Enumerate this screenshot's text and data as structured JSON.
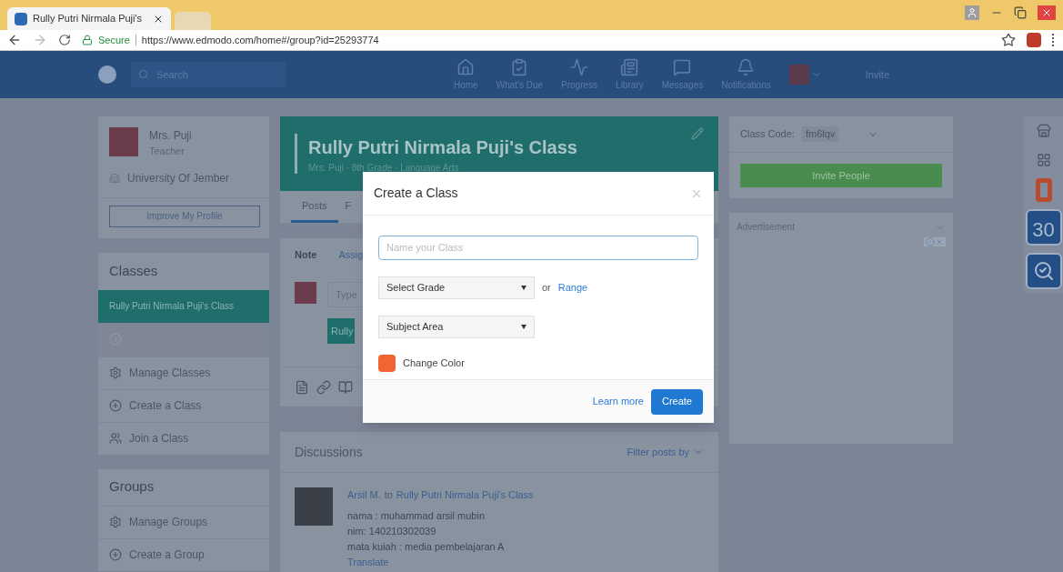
{
  "browser": {
    "tab_title": "Rully Putri Nirmala Puji's",
    "secure_label": "Secure",
    "url": "https://www.edmodo.com/home#/group?id=25293774"
  },
  "navbar": {
    "search_placeholder": "Search",
    "items": [
      {
        "label": "Home",
        "kind": "home"
      },
      {
        "label": "What's Due",
        "kind": "due"
      },
      {
        "label": "Progress",
        "kind": "progress"
      },
      {
        "label": "Library",
        "kind": "library"
      },
      {
        "label": "Messages",
        "kind": "messages"
      },
      {
        "label": "Notifications",
        "kind": "notifications"
      }
    ],
    "invite": "Invite"
  },
  "profile": {
    "name": "Mrs. Puji",
    "role": "Teacher",
    "school": "University Of Jember",
    "button": "Improve My Profile"
  },
  "classes": {
    "title": "Classes",
    "items": [
      {
        "label": "Rully Putri Nirmala Puji's Class",
        "selected": true
      }
    ],
    "actions": [
      {
        "label": "Manage Classes",
        "kind": "manage"
      },
      {
        "label": "Create a Class",
        "kind": "create"
      },
      {
        "label": "Join a Class",
        "kind": "join"
      }
    ]
  },
  "groups": {
    "title": "Groups",
    "actions": [
      {
        "label": "Manage Groups",
        "kind": "manage"
      },
      {
        "label": "Create a Group",
        "kind": "create"
      }
    ]
  },
  "class_header": {
    "title": "Rully Putri Nirmala Puji's Class",
    "subtitle": "Mrs. Puji · 8th Grade · Language Arts"
  },
  "class_tabs": [
    {
      "label": "Posts",
      "selected": true
    },
    {
      "label": "F",
      "selected": false
    }
  ],
  "composer": {
    "tabs": [
      {
        "label": "Note",
        "selected": true
      },
      {
        "label": "Assig",
        "selected": false
      }
    ],
    "placeholder": "Type",
    "chip": "Rully"
  },
  "discussions": {
    "title": "Discussions",
    "filter": "Filter posts by",
    "post": {
      "author": "Arsil M.",
      "connector": "to",
      "target": "Rully Putri Nirmala Puji's Class",
      "lines": [
        "nama : muhammad arsil mubin",
        "nim: 140210302039",
        "mata kuiah : media pembelajaran A"
      ],
      "translate": "Translate"
    }
  },
  "class_code": {
    "label": "Class Code:",
    "code": "fm6lqv",
    "invite": "Invite People"
  },
  "advertisement": {
    "label": "Advertisement"
  },
  "apps": [
    {
      "kind": "store"
    },
    {
      "kind": "grid"
    },
    {
      "kind": "office"
    },
    {
      "kind": "calendar",
      "label": "30"
    },
    {
      "kind": "quiz"
    }
  ],
  "modal": {
    "title": "Create a Class",
    "name_placeholder": "Name your Class",
    "grade_select": "Select Grade",
    "or": "or",
    "range": "Range",
    "subject_select": "Subject Area",
    "color": {
      "label": "Change Color",
      "color": "#f26531"
    },
    "learn_more": "Learn more",
    "create": "Create"
  }
}
